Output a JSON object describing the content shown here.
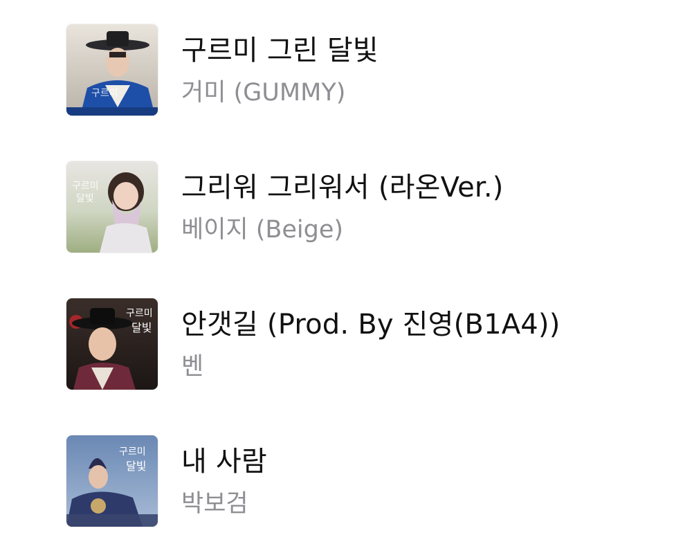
{
  "songs": [
    {
      "title": "구르미 그린 달빛",
      "artist": "거미 (GUMMY)",
      "art_icon": "album-art-1",
      "art_calligraphy": "구르미 그린 달빛"
    },
    {
      "title": "그리워 그리워서 (라온Ver.)",
      "artist": "베이지 (Beige)",
      "art_icon": "album-art-2",
      "art_calligraphy": "구르미 그린 달빛"
    },
    {
      "title": "안갯길 (Prod. By 진영(B1A4))",
      "artist": "벤",
      "art_icon": "album-art-3",
      "art_calligraphy": "구르미 그린 달빛"
    },
    {
      "title": "내 사람",
      "artist": "박보검",
      "art_icon": "album-art-4",
      "art_calligraphy": "구르미 그린 달빛"
    }
  ]
}
